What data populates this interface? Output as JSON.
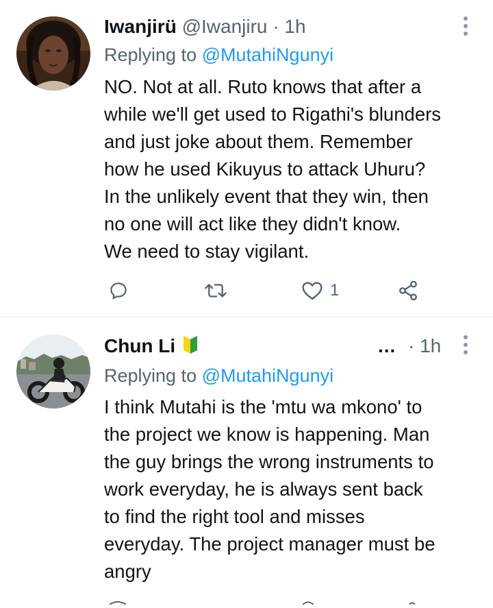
{
  "tweets": [
    {
      "display_name": "Iwanjirü",
      "handle": "@Iwanjiru",
      "separator": "·",
      "time": "1h",
      "replying_prefix": "Replying to",
      "replying_to": "@MutahiNgunyi",
      "body_lines": [
        "NO. Not at all. Ruto knows that after a",
        "while we'll get used to Rigathi's blunders",
        "and just joke about them. Remember",
        "how he used Kikuyus to attack Uhuru?",
        "In the unlikely event that they win, then",
        "no one will act like they didn't know.",
        "We need to stay vigilant."
      ],
      "like_count": "1",
      "icons": [
        "reply-icon",
        "retweet-icon",
        "like-icon",
        "share-icon",
        "more-icon"
      ]
    },
    {
      "display_name": "Chun Li",
      "badge_icon": "beginner-symbol-icon",
      "inline_dots": "...",
      "separator": "·",
      "time": "1h",
      "replying_prefix": "Replying to",
      "replying_to": "@MutahiNgunyi",
      "body_lines": [
        "I think Mutahi is the 'mtu wa mkono' to",
        "the project we know is happening. Man",
        "the guy brings the wrong instruments to",
        "work everyday, he is always sent back",
        "to find the right tool and misses",
        "everyday. The project manager must be",
        "angry"
      ],
      "icons": [
        "more-icon"
      ]
    }
  ],
  "colors": {
    "text": "#0f1419",
    "secondary": "#536471",
    "link": "#1d9bf0",
    "divider": "#e6ecf0",
    "badge_yellow": "#f5d415",
    "badge_green": "#2e9e3a"
  }
}
